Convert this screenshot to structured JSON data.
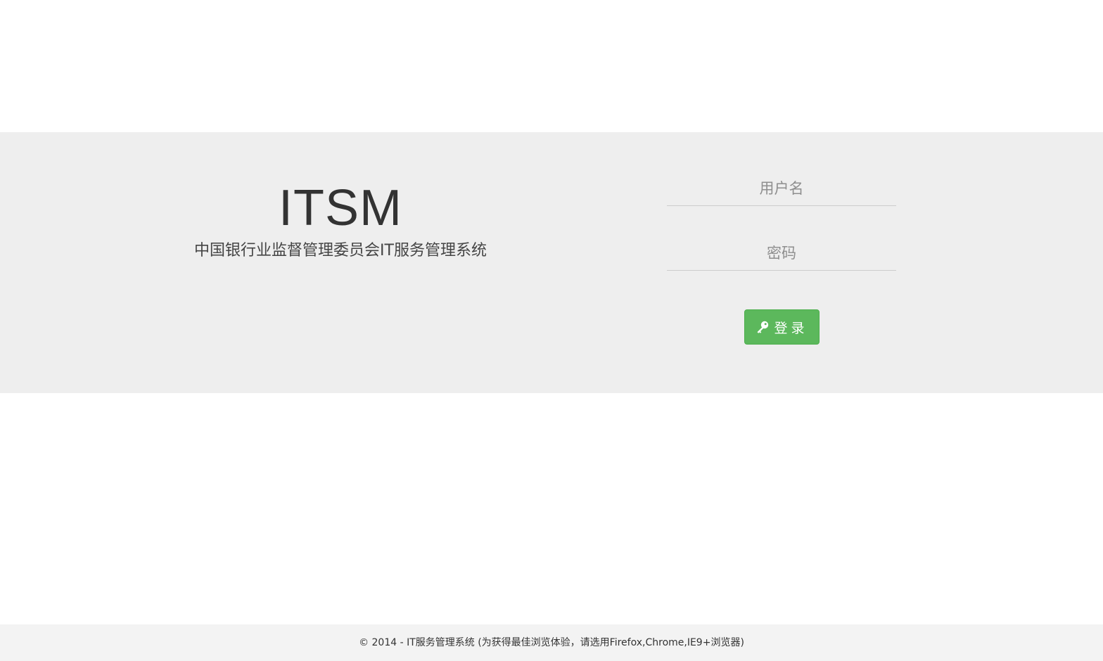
{
  "brand": {
    "title": "ITSM",
    "subtitle": "中国银行业监督管理委员会IT服务管理系统"
  },
  "login": {
    "username_placeholder": "用户名",
    "username_value": "",
    "password_placeholder": "密码",
    "password_value": "",
    "button_label": "登录",
    "button_icon": "key-icon"
  },
  "footer": {
    "text": "© 2014 - IT服务管理系统 (为获得最佳浏览体验，请选用Firefox,Chrome,IE9+浏览器)"
  },
  "colors": {
    "band_background": "#eeeeee",
    "button_green": "#5cb85c",
    "footer_background": "#f3f3f3"
  }
}
